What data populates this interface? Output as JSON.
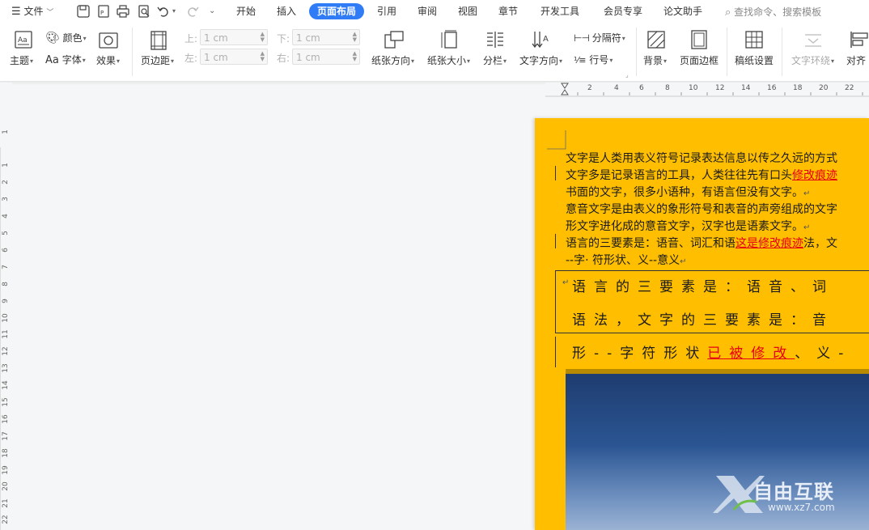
{
  "menubar": {
    "file_label": "文件",
    "tabs": [
      "开始",
      "插入",
      "页面布局",
      "引用",
      "审阅",
      "视图",
      "章节",
      "开发工具",
      "会员专享",
      "论文助手"
    ],
    "active_tab": "页面布局",
    "search_placeholder": "查找命令、搜索模板"
  },
  "ribbon": {
    "theme": "主题",
    "color": "颜色",
    "font": "字体",
    "font_icon": "Aa",
    "effect": "效果",
    "margins": "页边距",
    "top_label": "上:",
    "top_value": "1 cm",
    "bottom_label": "下:",
    "bottom_value": "1 cm",
    "left_label": "左:",
    "left_value": "1 cm",
    "right_label": "右:",
    "right_value": "1 cm",
    "orientation": "纸张方向",
    "size": "纸张大小",
    "columns": "分栏",
    "text_direction": "文字方向",
    "break": "分隔符",
    "line_number": "行号",
    "background": "背景",
    "page_border": "页面边框",
    "manuscript": "稿纸设置",
    "text_wrap": "文字环绕",
    "align": "对齐"
  },
  "ruler": {
    "h_ticks": [
      "2",
      "4",
      "6",
      "8",
      "10",
      "12",
      "14",
      "16",
      "18",
      "20",
      "22"
    ],
    "v_ticks": [
      "1",
      "1",
      "2",
      "3",
      "4",
      "5",
      "6",
      "7",
      "8",
      "9",
      "10",
      "11",
      "12",
      "13",
      "14",
      "15",
      "16",
      "17",
      "18",
      "19",
      "20",
      "21",
      "22"
    ]
  },
  "document": {
    "line1": "文字是人类用表义符号记录表达信息以传之久远的方式",
    "line2_pre": "文字多是记录语言的工具，人类往往先有口头",
    "line2_rev": "修改痕迹",
    "line3": "书面的文字，很多小语种，有语言但没有文字。",
    "line4": "意音文字是由表义的象形符号和表音的声旁组成的文字",
    "line5": "形文字进化成的意音文字，汉字也是语素文字。",
    "line6_pre": "语言的三要素是：语音、词汇和语",
    "line6_rev": "这是修改痕迹",
    "line6_post": "法，文",
    "line7": "--字· 符形状、义--意义",
    "box_line1": "语言的三要素是：语音、词",
    "box_line2": "语法，文字的三要素是：音",
    "box_line3_pre": "形--字符形状",
    "box_line3_rev": "已被修改",
    "box_line3_post": "、义-",
    "watermark_text": "自由互联",
    "watermark_url": "www.xz7.com"
  }
}
